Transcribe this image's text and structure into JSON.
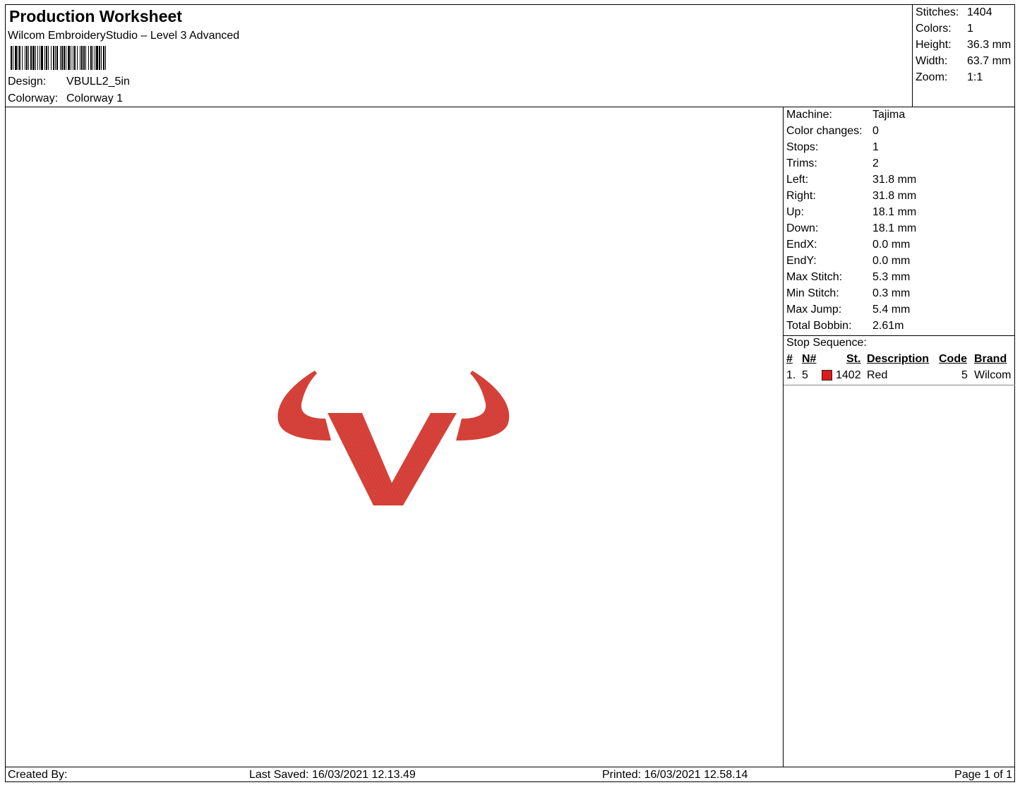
{
  "header": {
    "title": "Production Worksheet",
    "subtitle": "Wilcom EmbroideryStudio – Level 3 Advanced",
    "design_label": "Design:",
    "design_value": "VBULL2_5in",
    "colorway_label": "Colorway:",
    "colorway_value": "Colorway 1"
  },
  "summary": {
    "stitches_label": "Stitches:",
    "stitches_value": "1404",
    "colors_label": "Colors:",
    "colors_value": "1",
    "height_label": "Height:",
    "height_value": "36.3 mm",
    "width_label": "Width:",
    "width_value": "63.7 mm",
    "zoom_label": "Zoom:",
    "zoom_value": "1:1"
  },
  "info": {
    "rows": [
      {
        "label": "Machine:",
        "value": "Tajima"
      },
      {
        "label": "Color changes:",
        "value": "0"
      },
      {
        "label": "Stops:",
        "value": "1"
      },
      {
        "label": "Trims:",
        "value": "2"
      },
      {
        "label": "Left:",
        "value": "31.8 mm"
      },
      {
        "label": "Right:",
        "value": "31.8 mm"
      },
      {
        "label": "Up:",
        "value": "18.1 mm"
      },
      {
        "label": "Down:",
        "value": "18.1 mm"
      },
      {
        "label": "EndX:",
        "value": "0.0 mm"
      },
      {
        "label": "EndY:",
        "value": "0.0 mm"
      },
      {
        "label": "Max Stitch:",
        "value": "5.3 mm"
      },
      {
        "label": "Min Stitch:",
        "value": "0.3 mm"
      },
      {
        "label": "Max Jump:",
        "value": "5.4 mm"
      },
      {
        "label": "Total Bobbin:",
        "value": "2.61m"
      }
    ],
    "stop_sequence_title": "Stop Sequence:",
    "columns": {
      "num": "#",
      "n": "N#",
      "st": "St.",
      "description": "Description",
      "code": "Code",
      "brand": "Brand"
    },
    "stops": [
      {
        "num": "1.",
        "n": "5",
        "color": "#e01a1a",
        "st": "1402",
        "description": "Red",
        "code": "5",
        "brand": "Wilcom"
      }
    ]
  },
  "design": {
    "thread_color": "#d8423a",
    "stitch_shadow": "#9a2a24"
  },
  "footer": {
    "created_by": "Created By:",
    "last_saved": "Last Saved: 16/03/2021 12.13.49",
    "printed": "Printed: 16/03/2021 12.58.14",
    "page": "Page 1 of 1"
  }
}
